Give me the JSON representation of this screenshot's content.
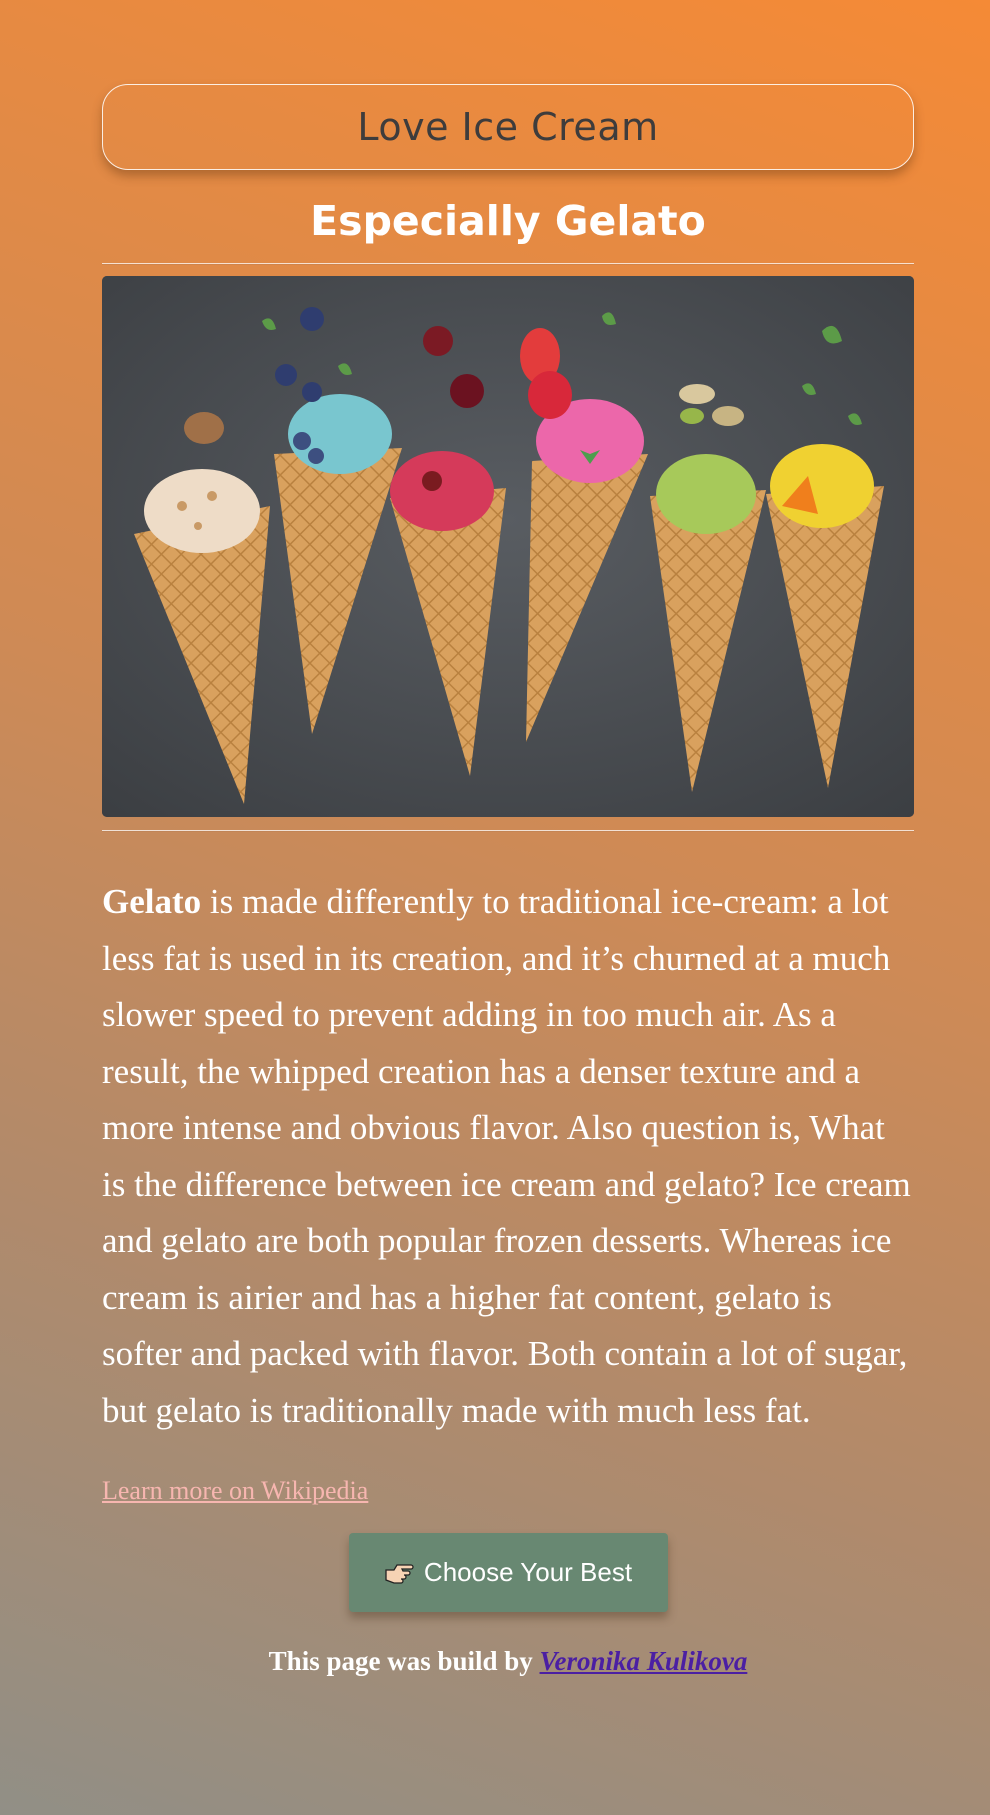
{
  "header": {
    "title": "Love Ice Cream",
    "subtitle": "Especially Gelato"
  },
  "hero_image": {
    "alt": "",
    "scoops": [
      "vanilla-nut",
      "blueberry",
      "cherry",
      "strawberry",
      "pistachio",
      "orange"
    ]
  },
  "description": {
    "lead": "Gelato",
    "body": " is made differently to traditional ice-cream: a lot less fat is used in its creation, and it’s churned at a much slower speed to prevent adding in too much air. As a result, the whipped creation has a denser texture and a more intense and obvious flavor. Also question is, What is the difference between ice cream and gelato? Ice cream and gelato are both popular frozen desserts. Whereas ice cream is airier and has a higher fat content, gelato is softer and packed with flavor. Both contain a lot of sugar, but gelato is traditionally made with much less fat."
  },
  "links": {
    "wikipedia": "Learn more on Wikipedia"
  },
  "cta": {
    "label": "Choose Your Best",
    "icon": "pointing-hand-icon"
  },
  "footer": {
    "prefix": "This page was build by",
    "author": "Veronika Kulikova"
  },
  "colors": {
    "button": "#688872",
    "link": "#f7b6b0",
    "author_link": "#4b1fa3",
    "bg_top": "#f58a36",
    "bg_bottom": "#918f86"
  }
}
